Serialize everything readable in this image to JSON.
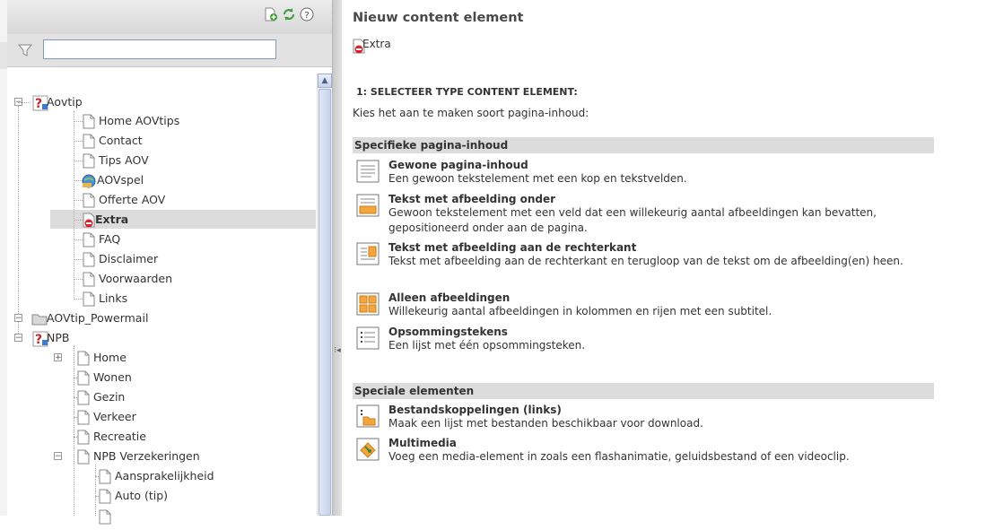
{
  "tree": {
    "filter": {
      "value": ""
    },
    "items": [
      {
        "label": "Aovtip"
      },
      {
        "label": "Home AOVtips"
      },
      {
        "label": "Contact"
      },
      {
        "label": "Tips AOV"
      },
      {
        "label": "AOVspel"
      },
      {
        "label": "Offerte AOV"
      },
      {
        "label": "Extra"
      },
      {
        "label": "FAQ"
      },
      {
        "label": "Disclaimer"
      },
      {
        "label": "Voorwaarden"
      },
      {
        "label": "Links"
      },
      {
        "label": "AOVtip_Powermail"
      },
      {
        "label": "NPB"
      },
      {
        "label": "Home"
      },
      {
        "label": "Wonen"
      },
      {
        "label": "Gezin"
      },
      {
        "label": "Verkeer"
      },
      {
        "label": "Recreatie"
      },
      {
        "label": "NPB Verzekeringen"
      },
      {
        "label": "Aansprakelijkheid"
      },
      {
        "label": "Auto (tip)"
      }
    ]
  },
  "content": {
    "title": "Nieuw content element",
    "page_ref": "Extra",
    "step_heading": "1: SELECTEER TYPE CONTENT ELEMENT:",
    "intro": "Kies het aan te maken soort pagina-inhoud:",
    "sections": [
      {
        "heading": "Specifieke pagina-inhoud",
        "items": [
          {
            "icon": "text-element-icon",
            "title": "Gewone pagina-inhoud",
            "desc": "Een gewoon tekstelement met een kop en tekstvelden."
          },
          {
            "icon": "text-image-below-icon",
            "title": "Tekst met afbeelding onder",
            "desc": "Gewoon tekstelement met een veld dat een willekeurig aantal afbeeldingen kan bevatten, gepositioneerd onder aan de pagina."
          },
          {
            "icon": "text-image-right-icon",
            "title": "Tekst met afbeelding aan de rechterkant",
            "desc": "Tekst met afbeelding aan de rechterkant en terugloop van de tekst om de afbeelding(en) heen."
          },
          {
            "icon": "images-only-icon",
            "title": "Alleen afbeeldingen",
            "desc": "Willekeurig aantal afbeeldingen in kolommen en rijen met een subtitel."
          },
          {
            "icon": "bullet-list-icon",
            "title": "Opsommingstekens",
            "desc": "Een lijst met één opsommingsteken."
          }
        ]
      },
      {
        "heading": "Speciale elementen",
        "items": [
          {
            "icon": "file-links-icon",
            "title": "Bestandskoppelingen (links)",
            "desc": "Maak een lijst met bestanden beschikbaar voor download."
          },
          {
            "icon": "multimedia-icon",
            "title": "Multimedia",
            "desc": "Voeg een media-element in zoals een flashanimatie, geluidsbestand of een videoclip."
          }
        ]
      }
    ]
  }
}
